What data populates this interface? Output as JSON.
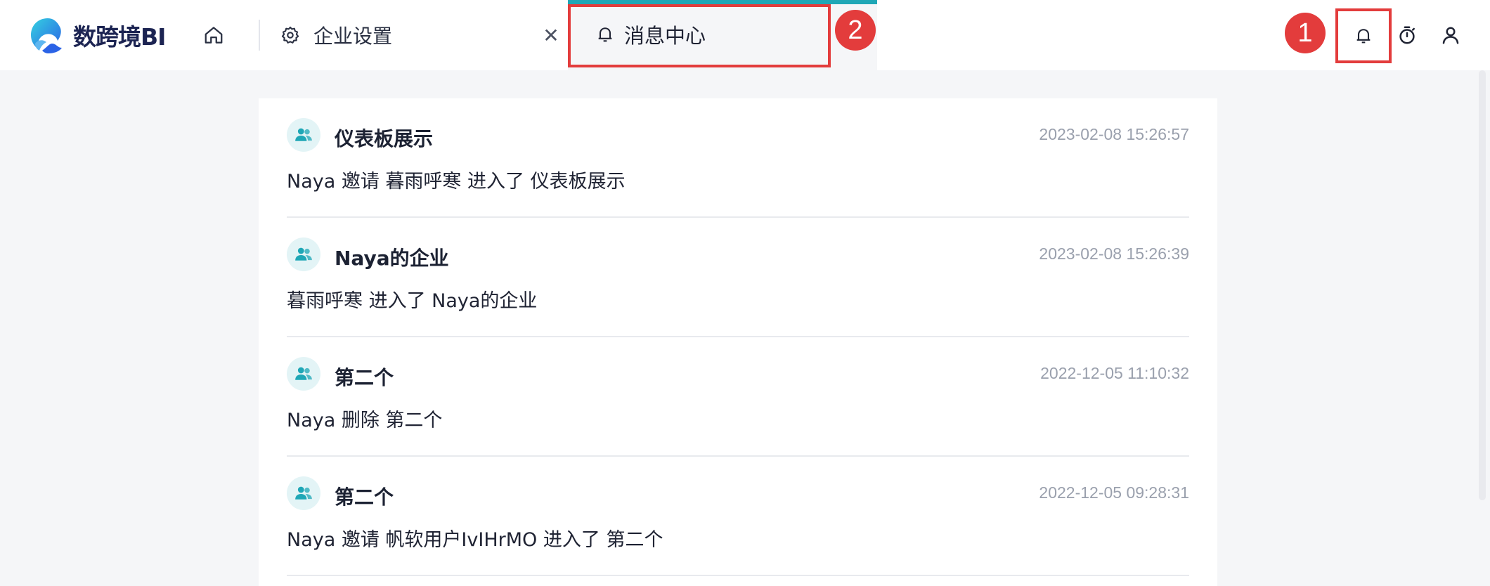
{
  "app": {
    "logo_text": "数跨境BI"
  },
  "tabs": [
    {
      "label": "企业设置",
      "icon": "gear-icon"
    },
    {
      "label": "消息中心",
      "icon": "bell-icon",
      "active": true
    }
  ],
  "markers": [
    "1",
    "2"
  ],
  "colors": {
    "accent": "#1fa7b6",
    "highlight": "#e33c3c",
    "timestamp": "#9aa0ad"
  },
  "messages": [
    {
      "title": "仪表板展示",
      "time": "2023-02-08 15:26:57",
      "body": "Naya 邀请 暮雨呼寒 进入了 仪表板展示"
    },
    {
      "title": "Naya的企业",
      "time": "2023-02-08 15:26:39",
      "body": "暮雨呼寒 进入了 Naya的企业"
    },
    {
      "title": "第二个",
      "time": "2022-12-05 11:10:32",
      "body": "Naya 删除 第二个"
    },
    {
      "title": "第二个",
      "time": "2022-12-05 09:28:31",
      "body": "Naya 邀请 帆软用户IvIHrMO 进入了 第二个"
    }
  ]
}
